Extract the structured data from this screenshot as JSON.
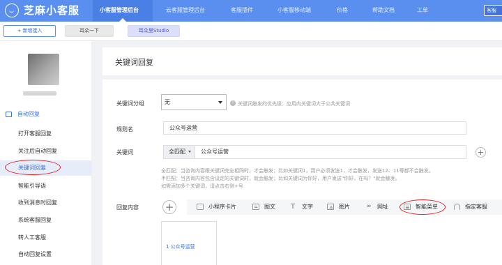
{
  "nav": {
    "logo_text": "芝麻小客服",
    "items": [
      {
        "label": "小客服管理后台"
      },
      {
        "label": "云客服管理后台"
      },
      {
        "label": "客服插件"
      },
      {
        "label": "小客服移动端"
      },
      {
        "label": "价格"
      },
      {
        "label": "帮助文档"
      },
      {
        "label": "工单"
      }
    ],
    "right_button": "客服"
  },
  "toolbar": {
    "add_label": "+ 新增接入",
    "account1_label": "耳朵一下",
    "account2_label": "耳朵里Studio"
  },
  "sidebar": {
    "section_label": "自动回复",
    "items": [
      {
        "label": "打开客服回复"
      },
      {
        "label": "关注后自动回复"
      },
      {
        "label": "关键词回复"
      },
      {
        "label": "智能引导语"
      },
      {
        "label": "收到消息时回复"
      },
      {
        "label": "系统客服回复"
      },
      {
        "label": "转人工客服"
      },
      {
        "label": "自动回复设置"
      }
    ],
    "active_index": 2
  },
  "main": {
    "title": "关键词回复",
    "group": {
      "label": "关键词分组",
      "value": "无",
      "hint_icon": "!",
      "hint": "关键词触发的优先级：应用内关键词大于公共关键词"
    },
    "rule_name": {
      "label": "规则名",
      "value": "公众号运营"
    },
    "keyword": {
      "label": "关键词",
      "match_label": "全匹配",
      "value": "公众号运营",
      "add_symbol": "+",
      "desc_lines": [
        "全匹配：当咨询内容跟关键词完全相同时，才会触发；比如关键词1，用户必须发送1，才会触发，发送12、11等都不会触发。",
        "半匹配：当咨询内容包含设定的关键词时，就会触发；比如关键词为你好，用户发送\"你好，在吗？\"就会触发。",
        "如需添加多个关键词，请点击右侧+号"
      ]
    },
    "reply": {
      "label": "回复内容",
      "add_symbol": "+",
      "tabs": [
        {
          "label": "小程序卡片",
          "icon": "miniprogram-card-icon"
        },
        {
          "label": "图文",
          "icon": "article-icon"
        },
        {
          "label": "文字",
          "icon": "text-icon"
        },
        {
          "label": "图片",
          "icon": "image-icon"
        },
        {
          "label": "网址",
          "icon": "link-icon"
        },
        {
          "label": "智能菜单",
          "icon": "menu-icon"
        },
        {
          "label": "指定客服",
          "icon": "headset-icon"
        }
      ],
      "preview_text": "1 公众号运营"
    }
  },
  "colors": {
    "nav_bg": "#5a8ff0",
    "accent": "#3a6fd8",
    "highlight_circle": "#e02020"
  }
}
